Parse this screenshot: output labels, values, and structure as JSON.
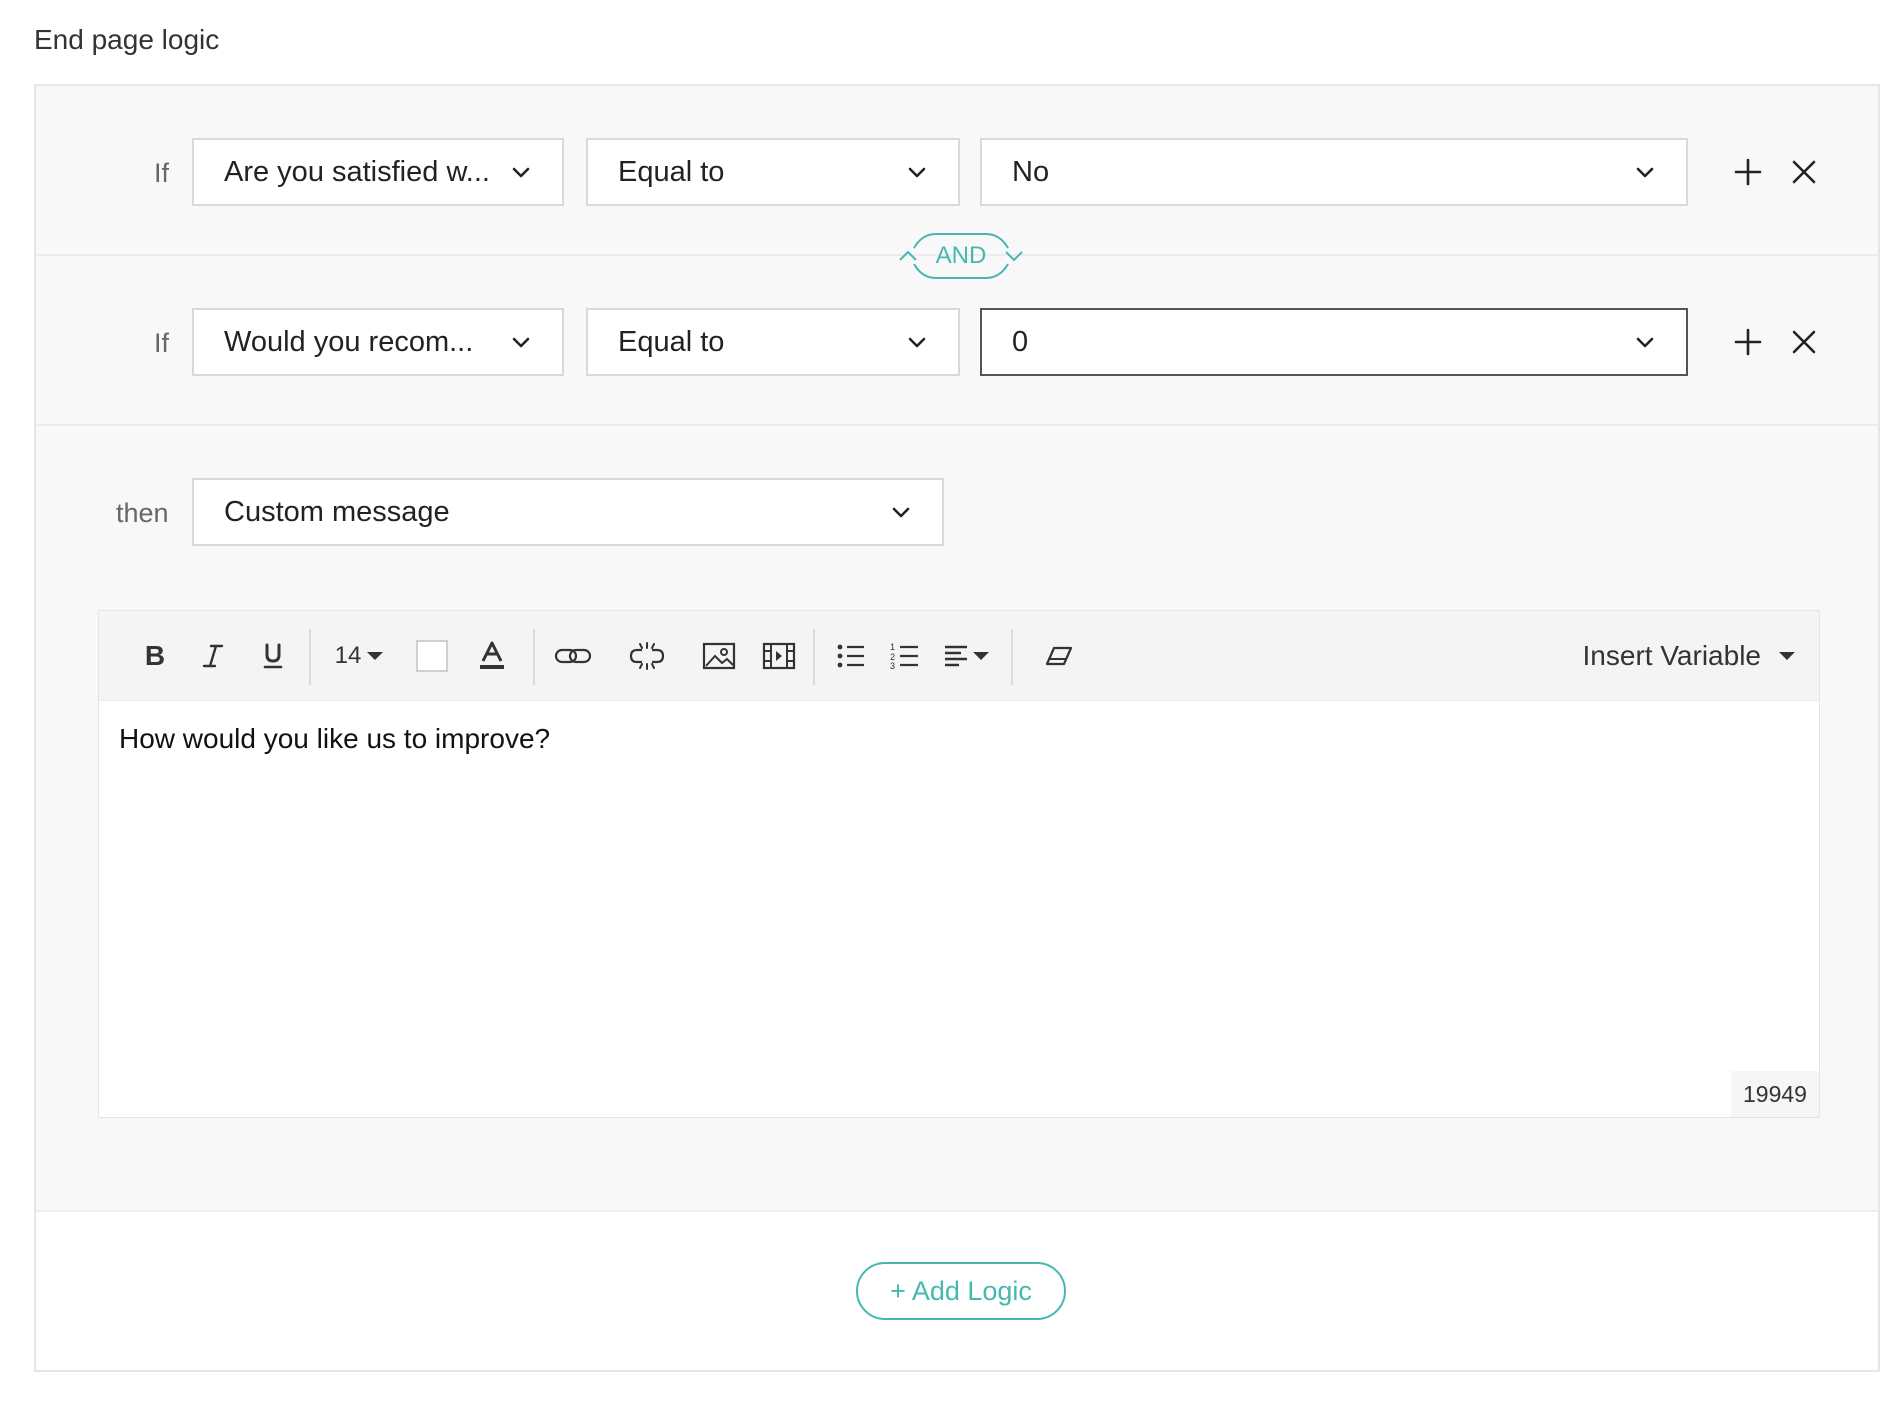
{
  "section_title": "End page logic",
  "conditions": [
    {
      "label": "If",
      "question": "Are you satisfied w...",
      "operator": "Equal to",
      "value": "No"
    },
    {
      "label": "If",
      "question": "Would you recom...",
      "operator": "Equal to",
      "value": "0"
    }
  ],
  "connector": "AND",
  "then": {
    "label": "then",
    "action": "Custom message"
  },
  "editor": {
    "toolbar": {
      "font_size": "14",
      "insert_variable": "Insert Variable"
    },
    "content": "How would you like us to improve?",
    "char_count": "19949"
  },
  "add_logic_label": "+ Add Logic",
  "colors": {
    "accent": "#46b8b0",
    "panel_bg": "#f8f8f8",
    "border": "#d9d9d9"
  },
  "icons": [
    "chevron-down-icon",
    "plus-icon",
    "close-icon",
    "bold-icon",
    "italic-icon",
    "underline-icon",
    "font-color-icon",
    "link-icon",
    "unlink-icon",
    "image-icon",
    "video-icon",
    "bullet-list-icon",
    "numbered-list-icon",
    "align-icon",
    "eraser-icon"
  ]
}
